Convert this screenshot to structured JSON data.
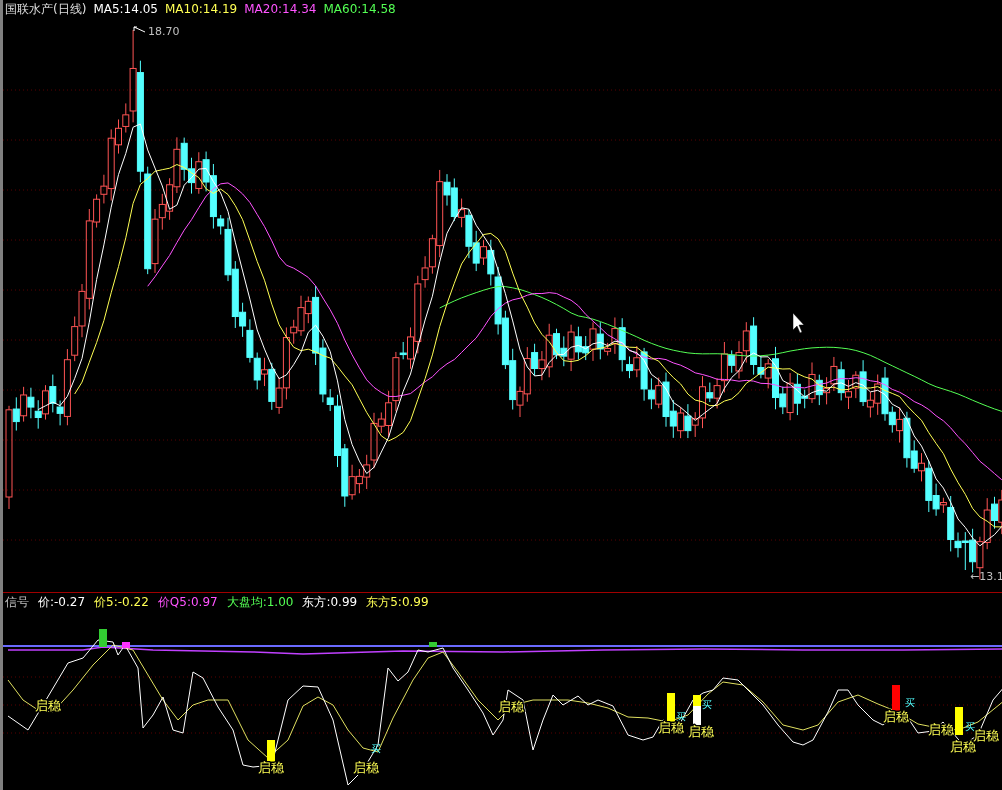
{
  "header": {
    "title": "国联水产(日线)",
    "indicators": [
      {
        "text": "MA5:14.05",
        "color": "#ffffff"
      },
      {
        "text": "MA10:14.19",
        "color": "#ffff54"
      },
      {
        "text": "MA20:14.34",
        "color": "#ff54ff"
      },
      {
        "text": "MA60:14.58",
        "color": "#54ff54"
      }
    ]
  },
  "price_chart": {
    "high_label": "18.70",
    "low_label": "←13.1"
  },
  "indicator_panel": {
    "header": [
      {
        "text": "信号"
      },
      {
        "text": "价:-0.27",
        "color": "#ffffff"
      },
      {
        "text": "价5:-0.22",
        "color": "#ffff54"
      },
      {
        "text": "价Q5:0.97",
        "color": "#ff54ff"
      },
      {
        "text": "大盘均:1.00",
        "color": "#54ff54"
      },
      {
        "text": "东方:0.99",
        "color": "#ffffff"
      },
      {
        "text": "东方5:0.99",
        "color": "#ffff54"
      }
    ],
    "markers": [
      {
        "kind": "bar",
        "color": "#33cc33"
      },
      {
        "kind": "bar",
        "color": "#ff33ff"
      },
      {
        "kind": "bar",
        "color": "#33cc33"
      },
      {
        "kind": "label",
        "text": "启稳"
      },
      {
        "kind": "bar",
        "color": "#ffff00"
      },
      {
        "kind": "label",
        "text": "启稳"
      },
      {
        "kind": "buy",
        "text": "买"
      },
      {
        "kind": "label",
        "text": "启稳"
      },
      {
        "kind": "label",
        "text": "启稳"
      },
      {
        "kind": "bar",
        "color": "#ffff00"
      },
      {
        "kind": "buy",
        "text": "买"
      },
      {
        "kind": "label",
        "text": "启稳"
      },
      {
        "kind": "bar",
        "color": "#ffff00"
      },
      {
        "kind": "bar",
        "color": "#ffffff"
      },
      {
        "kind": "buy",
        "text": "买"
      },
      {
        "kind": "label",
        "text": "启稳"
      },
      {
        "kind": "bar",
        "color": "#ff0000"
      },
      {
        "kind": "buy",
        "text": "买"
      },
      {
        "kind": "label",
        "text": "启稳"
      },
      {
        "kind": "label",
        "text": "启稳"
      },
      {
        "kind": "bar",
        "color": "#ffff00"
      },
      {
        "kind": "buy",
        "text": "买"
      },
      {
        "kind": "label",
        "text": "启稳"
      },
      {
        "kind": "label",
        "text": "启稳"
      }
    ]
  }
}
